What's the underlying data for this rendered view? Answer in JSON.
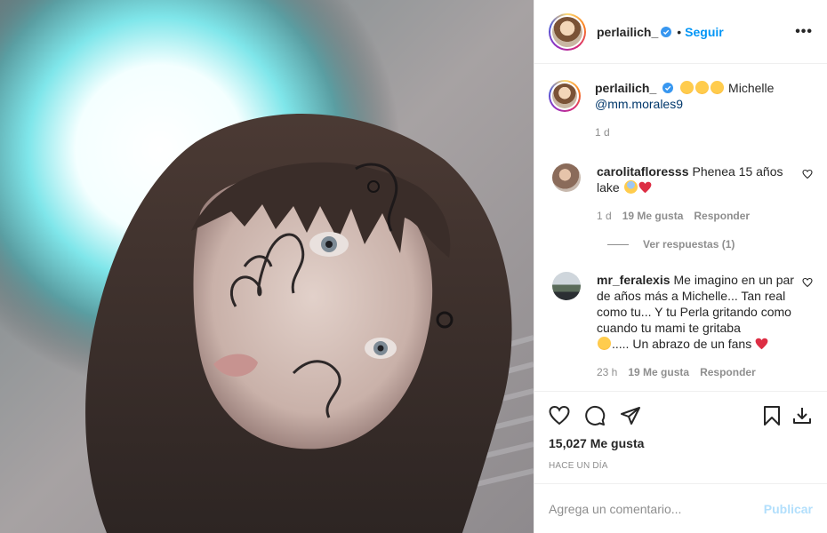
{
  "post": {
    "author": "perlailich_",
    "follow_label": "Seguir",
    "separator": "•",
    "more_label": "•••",
    "caption_tail": " Michelle",
    "caption_mention": "@mm.morales9",
    "caption_time": "1 d",
    "photo_alt": ""
  },
  "comments": [
    {
      "user": "carolitafloresss",
      "text": "Phenea 15 años lake",
      "time": "1 d",
      "likes": "19 Me gusta",
      "reply": "Responder",
      "view_replies": "Ver respuestas (1)"
    },
    {
      "user": "mr_feralexis",
      "text": "Me imagino en un par de años más a Michelle... Tan real como tu... Y tu Perla gritando como cuando tu mami te gritaba",
      "text_tail": "..... Un abrazo de un fans",
      "time": "23 h",
      "likes": "19 Me gusta",
      "reply": "Responder"
    }
  ],
  "footer": {
    "likes": "15,027 Me gusta",
    "ago": "HACE UN DÍA",
    "comment_placeholder": "Agrega un comentario...",
    "publish_label": "Publicar"
  },
  "colors": {
    "accent": "#0095f6",
    "publish_disabled": "#b2dffc",
    "muted": "#8e8e8e",
    "heart_red": "#ed4956"
  },
  "icons": [
    "verified-icon",
    "like-icon",
    "comment-icon",
    "share-icon",
    "save-icon",
    "download-icon",
    "more-icon"
  ]
}
